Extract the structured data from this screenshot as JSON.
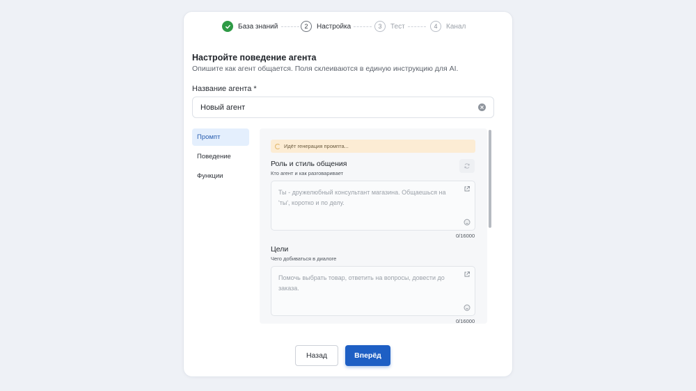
{
  "stepper": {
    "steps": [
      {
        "number": "",
        "label": "База знаний",
        "state": "done"
      },
      {
        "number": "2",
        "label": "Настройка",
        "state": "active"
      },
      {
        "number": "3",
        "label": "Тест",
        "state": "upcoming"
      },
      {
        "number": "4",
        "label": "Канал",
        "state": "upcoming"
      }
    ]
  },
  "header": {
    "title": "Настройте поведение агента",
    "subtitle": "Опишите как агент общается. Поля склеиваются в единую инструкцию для AI."
  },
  "agent_name": {
    "label": "Название агента *",
    "value": "Новый агент"
  },
  "tabs": [
    {
      "label": "Промпт",
      "active": true
    },
    {
      "label": "Поведение",
      "active": false
    },
    {
      "label": "Функции",
      "active": false
    }
  ],
  "prompt_panel": {
    "generation_status": "Идёт генерация промпта...",
    "sections": [
      {
        "title": "Роль и стиль общения",
        "subtitle": "Кто агент и как разговаривает",
        "placeholder": "Ты - дружелюбный консультант магазина. Общаешься на 'ты', коротко и по делу.",
        "counter": "0/16000"
      },
      {
        "title": "Цели",
        "subtitle": "Чего добиваться в диалоге",
        "placeholder": "Помочь выбрать товар, ответить на вопросы, довести до заказа.",
        "counter": "0/16000"
      }
    ]
  },
  "footer": {
    "back_label": "Назад",
    "next_label": "Вперёд"
  },
  "colors": {
    "accent": "#1e5fc4",
    "success": "#2e9a45",
    "generation_bg": "#fcecd4",
    "tab_active_bg": "#e4effd"
  }
}
